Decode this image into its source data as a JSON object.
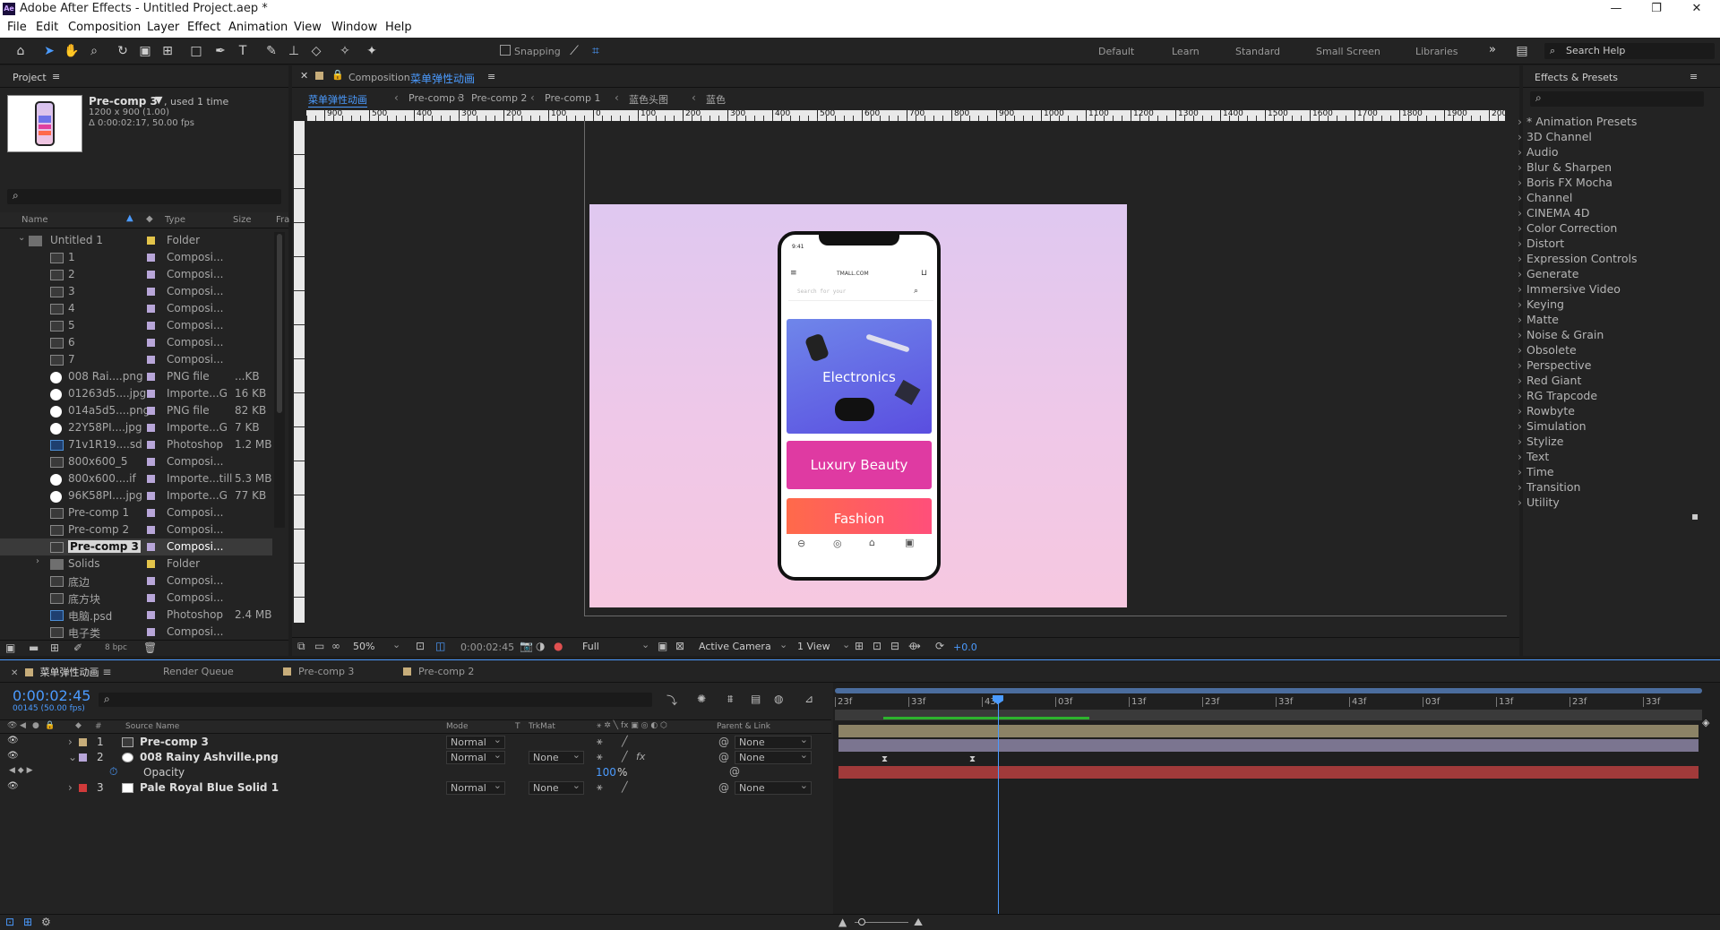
{
  "window": {
    "title": "Adobe After Effects - Untitled Project.aep *",
    "logo": "Ae"
  },
  "menu": [
    "File",
    "Edit",
    "Composition",
    "Layer",
    "Effect",
    "Animation",
    "View",
    "Window",
    "Help"
  ],
  "toolbar": {
    "snapping": "Snapping",
    "workspaces": [
      "Default",
      "Learn",
      "Standard",
      "Small Screen",
      "Libraries"
    ],
    "more": "»",
    "search_help": "Search Help"
  },
  "project": {
    "tab": "Project",
    "selected_name": "Pre-comp 3",
    "used": ", used 1 time",
    "dims": "1200 x 900 (1.00)",
    "duration": "Δ 0:00:02:17, 50.00 fps",
    "columns": {
      "name": "Name",
      "type": "Type",
      "size": "Size",
      "fr": "Fra"
    },
    "bpc": "8 bpc",
    "items": [
      {
        "name": "Untitled 1",
        "type": "Folder",
        "size": "",
        "icon": "folder",
        "label": "#e3c44a",
        "level": 0
      },
      {
        "name": "1",
        "type": "Composi...",
        "size": "",
        "icon": "comp",
        "label": "#b8a6d9",
        "level": 1
      },
      {
        "name": "2",
        "type": "Composi...",
        "size": "",
        "icon": "comp",
        "label": "#b8a6d9",
        "level": 1
      },
      {
        "name": "3",
        "type": "Composi...",
        "size": "",
        "icon": "comp",
        "label": "#b8a6d9",
        "level": 1
      },
      {
        "name": "4",
        "type": "Composi...",
        "size": "",
        "icon": "comp",
        "label": "#b8a6d9",
        "level": 1
      },
      {
        "name": "5",
        "type": "Composi...",
        "size": "",
        "icon": "comp",
        "label": "#b8a6d9",
        "level": 1
      },
      {
        "name": "6",
        "type": "Composi...",
        "size": "",
        "icon": "comp",
        "label": "#b8a6d9",
        "level": 1
      },
      {
        "name": "7",
        "type": "Composi...",
        "size": "",
        "icon": "comp",
        "label": "#b8a6d9",
        "level": 1
      },
      {
        "name": "008 Rai....png",
        "type": "PNG file",
        "size": "...KB",
        "icon": "png",
        "label": "#b8a6d9",
        "level": 1
      },
      {
        "name": "01263d5....jpg",
        "type": "Importe...G",
        "size": "16 KB",
        "icon": "png",
        "label": "#b8a6d9",
        "level": 1
      },
      {
        "name": "014a5d5....png",
        "type": "PNG file",
        "size": "82 KB",
        "icon": "png",
        "label": "#b8a6d9",
        "level": 1
      },
      {
        "name": "22Y58PI....jpg",
        "type": "Importe...G",
        "size": "7 KB",
        "icon": "png",
        "label": "#b8a6d9",
        "level": 1
      },
      {
        "name": "71v1R19....sd",
        "type": "Photoshop",
        "size": "1.2 MB",
        "icon": "ps",
        "label": "#b8a6d9",
        "level": 1
      },
      {
        "name": "800x600_5",
        "type": "Composi...",
        "size": "",
        "icon": "comp",
        "label": "#b8a6d9",
        "level": 1
      },
      {
        "name": "800x600....if",
        "type": "Importe...till",
        "size": "5.3 MB",
        "icon": "png",
        "label": "#b8a6d9",
        "level": 1
      },
      {
        "name": "96K58PI....jpg",
        "type": "Importe...G",
        "size": "77 KB",
        "icon": "png",
        "label": "#b8a6d9",
        "level": 1
      },
      {
        "name": "Pre-comp 1",
        "type": "Composi...",
        "size": "",
        "icon": "comp",
        "label": "#b8a6d9",
        "level": 1
      },
      {
        "name": "Pre-comp 2",
        "type": "Composi...",
        "size": "",
        "icon": "comp",
        "label": "#b8a6d9",
        "level": 1
      },
      {
        "name": "Pre-comp 3",
        "type": "Composi...",
        "size": "",
        "icon": "comp",
        "label": "#b8a6d9",
        "level": 1,
        "selected": true
      },
      {
        "name": "Solids",
        "type": "Folder",
        "size": "",
        "icon": "folder",
        "label": "#e3c44a",
        "level": 1,
        "collapsed": true
      },
      {
        "name": "底边",
        "type": "Composi...",
        "size": "",
        "icon": "comp",
        "label": "#b8a6d9",
        "level": 1
      },
      {
        "name": "底方块",
        "type": "Composi...",
        "size": "",
        "icon": "comp",
        "label": "#b8a6d9",
        "level": 1
      },
      {
        "name": "电脑.psd",
        "type": "Photoshop",
        "size": "2.4 MB",
        "icon": "ps",
        "label": "#b8a6d9",
        "level": 1
      },
      {
        "name": "电子类",
        "type": "Composi...",
        "size": "",
        "icon": "comp",
        "label": "#b8a6d9",
        "level": 1
      }
    ]
  },
  "composition": {
    "prefix": "Composition",
    "name": "菜单弹性动画",
    "breadcrumbs": [
      "菜单弹性动画",
      "Pre-comp 3",
      "Pre-comp 2",
      "Pre-comp 1",
      "蓝色头图",
      "蓝色"
    ],
    "ruler_ticks": [
      "900",
      "500",
      "400",
      "300",
      "200",
      "100",
      "0",
      "100",
      "200",
      "300",
      "400",
      "500",
      "600",
      "700",
      "800",
      "900",
      "1000",
      "1100",
      "1200",
      "1300",
      "1400",
      "1500",
      "1600",
      "1700",
      "1800",
      "1900",
      "2000"
    ],
    "zoom": "50%",
    "timecode": "0:00:02:45",
    "resolution": "Full",
    "camera": "Active Camera",
    "views": "1 View",
    "exposure": "+0.0",
    "phone": {
      "time": "9:41",
      "brand": "TMALL.COM",
      "search": "Search for your",
      "categories": [
        "Electronics",
        "Luxury Beauty",
        "Fashion"
      ]
    }
  },
  "effects": {
    "tab": "Effects & Presets",
    "items": [
      "* Animation Presets",
      "3D Channel",
      "Audio",
      "Blur & Sharpen",
      "Boris FX Mocha",
      "Channel",
      "CINEMA 4D",
      "Color Correction",
      "Distort",
      "Expression Controls",
      "Generate",
      "Immersive Video",
      "Keying",
      "Matte",
      "Noise & Grain",
      "Obsolete",
      "Perspective",
      "Red Giant",
      "RG Trapcode",
      "Rowbyte",
      "Simulation",
      "Stylize",
      "Text",
      "Time",
      "Transition",
      "Utility"
    ]
  },
  "timeline": {
    "tabs": [
      "菜单弹性动画",
      "Render Queue",
      "Pre-comp 3",
      "Pre-comp 2"
    ],
    "timecode": "0:00:02:45",
    "frames": "00145 (50.00 fps)",
    "columns": {
      "source": "Source Name",
      "mode": "Mode",
      "t": "T",
      "trkmat": "TrkMat",
      "parent": "Parent & Link"
    },
    "ticks": [
      "23f",
      "33f",
      "43f",
      "03f",
      "13f",
      "23f",
      "33f",
      "43f",
      "03f",
      "13f",
      "23f",
      "33f"
    ],
    "layers": [
      {
        "num": "1",
        "name": "Pre-comp 3",
        "mode": "Normal",
        "trkmat": "",
        "parent": "None",
        "label": "#c7ad7a",
        "bar": "#8a7e5e"
      },
      {
        "num": "2",
        "name": "008 Rainy Ashville.png",
        "mode": "Normal",
        "trkmat": "None",
        "parent": "None",
        "label": "#b8a6d9",
        "bar": "#7d7690"
      },
      {
        "num": "3",
        "name": "Pale Royal Blue Solid 1",
        "mode": "Normal",
        "trkmat": "None",
        "parent": "None",
        "label": "#d03a3a",
        "bar": "#a03a3a"
      }
    ],
    "property": {
      "name": "Opacity",
      "value": "100",
      "unit": "%"
    }
  }
}
